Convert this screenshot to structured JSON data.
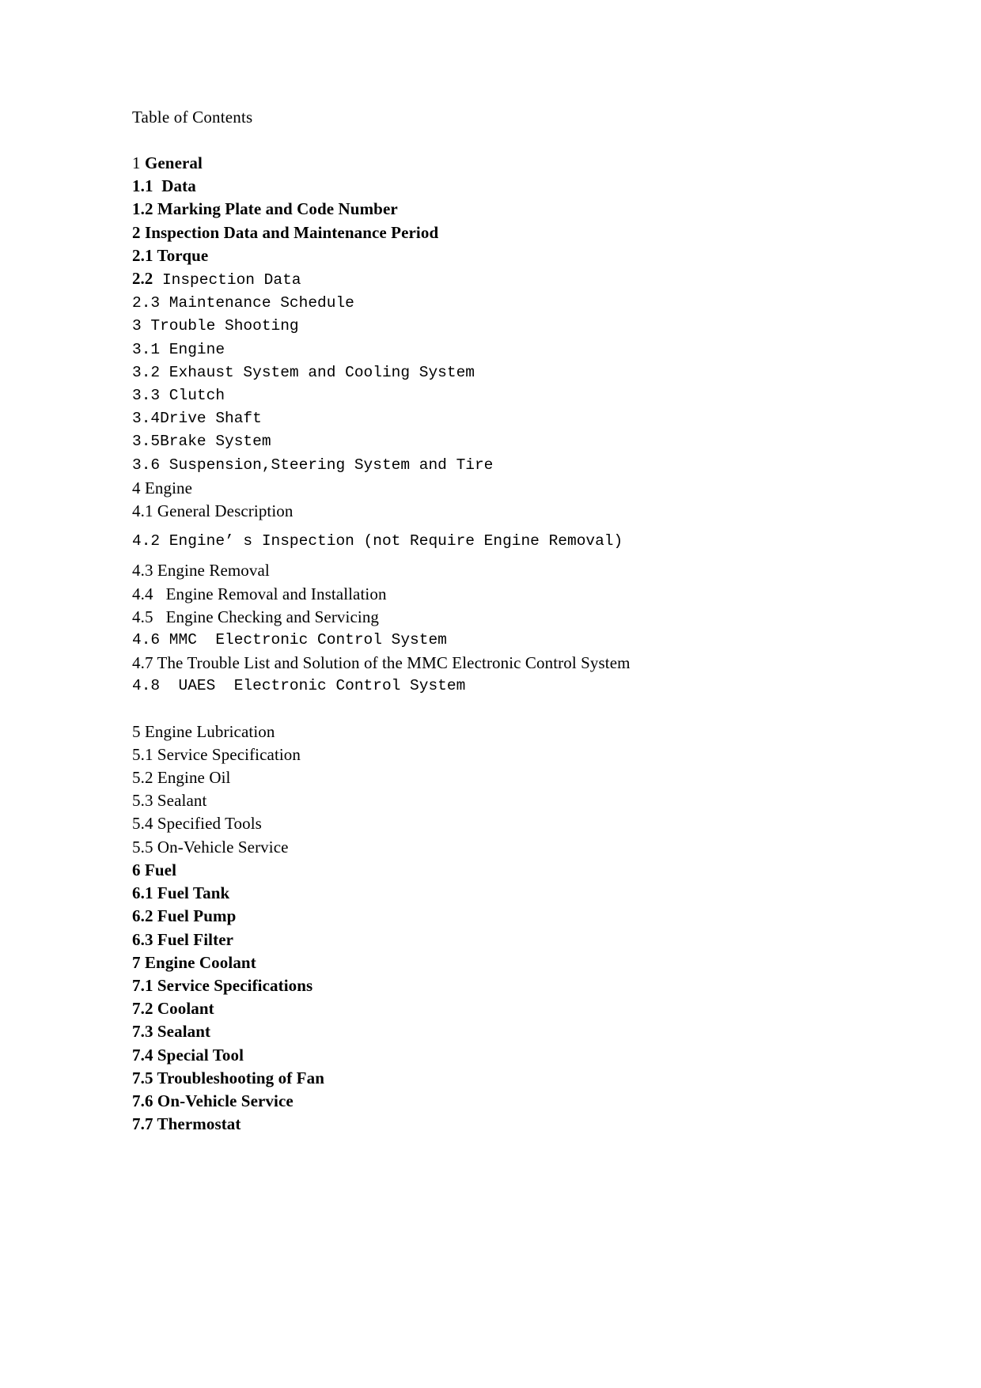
{
  "document": {
    "title": "Table of Contents"
  },
  "toc": {
    "entries": [
      {
        "id": "1",
        "style": "mixed-serif",
        "number": "1 ",
        "text": "General"
      },
      {
        "id": "1.1",
        "style": "serif-bold",
        "line": "1.1  Data"
      },
      {
        "id": "1.2",
        "style": "serif-bold",
        "line": "1.2 Marking Plate and Code Number"
      },
      {
        "id": "2",
        "style": "serif-bold",
        "line": "2 Inspection Data and Maintenance Period"
      },
      {
        "id": "2.1",
        "style": "serif-bold",
        "line": "2.1 Torque"
      },
      {
        "id": "2.2",
        "style": "mixed",
        "number": "2.2",
        "text": " Inspection Data"
      },
      {
        "id": "2.3",
        "style": "mono",
        "line": "2.3 Maintenance Schedule"
      },
      {
        "id": "3",
        "style": "mono",
        "line": "3 Trouble Shooting"
      },
      {
        "id": "3.1",
        "style": "mono",
        "line": "3.1 Engine"
      },
      {
        "id": "3.2",
        "style": "mono",
        "line": "3.2 Exhaust System and Cooling System"
      },
      {
        "id": "3.3",
        "style": "mono",
        "line": "3.3 Clutch"
      },
      {
        "id": "3.4",
        "style": "mono",
        "line": "3.4Drive Shaft"
      },
      {
        "id": "3.5",
        "style": "mono",
        "line": "3.5Brake System"
      },
      {
        "id": "3.6",
        "style": "mono",
        "line": "3.6 Suspension,Steering System and Tire"
      },
      {
        "id": "4",
        "style": "serif",
        "line": "4 Engine"
      },
      {
        "id": "4.1",
        "style": "serif",
        "line": "4.1 General Description"
      },
      {
        "id": "4.2",
        "style": "mono-spaced",
        "line": "4.2 Engine’ s Inspection (not Require Engine Removal)"
      },
      {
        "id": "4.3",
        "style": "serif",
        "line": "4.3 Engine Removal"
      },
      {
        "id": "4.4",
        "style": "serif",
        "line": "4.4   Engine Removal and Installation"
      },
      {
        "id": "4.5",
        "style": "serif",
        "line": "4.5   Engine Checking and Servicing"
      },
      {
        "id": "4.6",
        "style": "mono",
        "line": "4.6 MMC  Electronic Control System"
      },
      {
        "id": "4.7",
        "style": "serif",
        "line": "4.7 The Trouble List and Solution of the MMC Electronic Control System"
      },
      {
        "id": "4.8",
        "style": "mono",
        "line": "4.8  UAES  Electronic Control System"
      },
      {
        "id": "5",
        "style": "serif-gap",
        "line": "5 Engine Lubrication"
      },
      {
        "id": "5.1",
        "style": "serif",
        "line": "5.1 Service Specification"
      },
      {
        "id": "5.2",
        "style": "serif",
        "line": "5.2 Engine Oil"
      },
      {
        "id": "5.3",
        "style": "serif",
        "line": "5.3 Sealant"
      },
      {
        "id": "5.4",
        "style": "serif",
        "line": "5.4 Specified Tools"
      },
      {
        "id": "5.5",
        "style": "serif",
        "line": "5.5 On-Vehicle Service"
      },
      {
        "id": "6",
        "style": "serif-bold",
        "line": "6 Fuel"
      },
      {
        "id": "6.1",
        "style": "serif-bold",
        "line": "6.1 Fuel Tank"
      },
      {
        "id": "6.2",
        "style": "serif-bold",
        "line": "6.2 Fuel Pump"
      },
      {
        "id": "6.3",
        "style": "serif-bold",
        "line": "6.3 Fuel Filter"
      },
      {
        "id": "7",
        "style": "serif-bold",
        "line": "7 Engine Coolant"
      },
      {
        "id": "7.1",
        "style": "serif-bold",
        "line": "7.1 Service Specifications"
      },
      {
        "id": "7.2",
        "style": "serif-bold",
        "line": "7.2 Coolant"
      },
      {
        "id": "7.3",
        "style": "serif-bold",
        "line": "7.3 Sealant"
      },
      {
        "id": "7.4",
        "style": "serif-bold",
        "line": "7.4 Special Tool"
      },
      {
        "id": "7.5",
        "style": "serif-bold",
        "line": "7.5 Troubleshooting of Fan"
      },
      {
        "id": "7.6",
        "style": "serif-bold",
        "line": "7.6 On-Vehicle Service"
      },
      {
        "id": "7.7",
        "style": "serif-bold",
        "line": "7.7 Thermostat"
      }
    ]
  },
  "colors": {
    "page_background": "#ffffff",
    "text": "#000000"
  }
}
